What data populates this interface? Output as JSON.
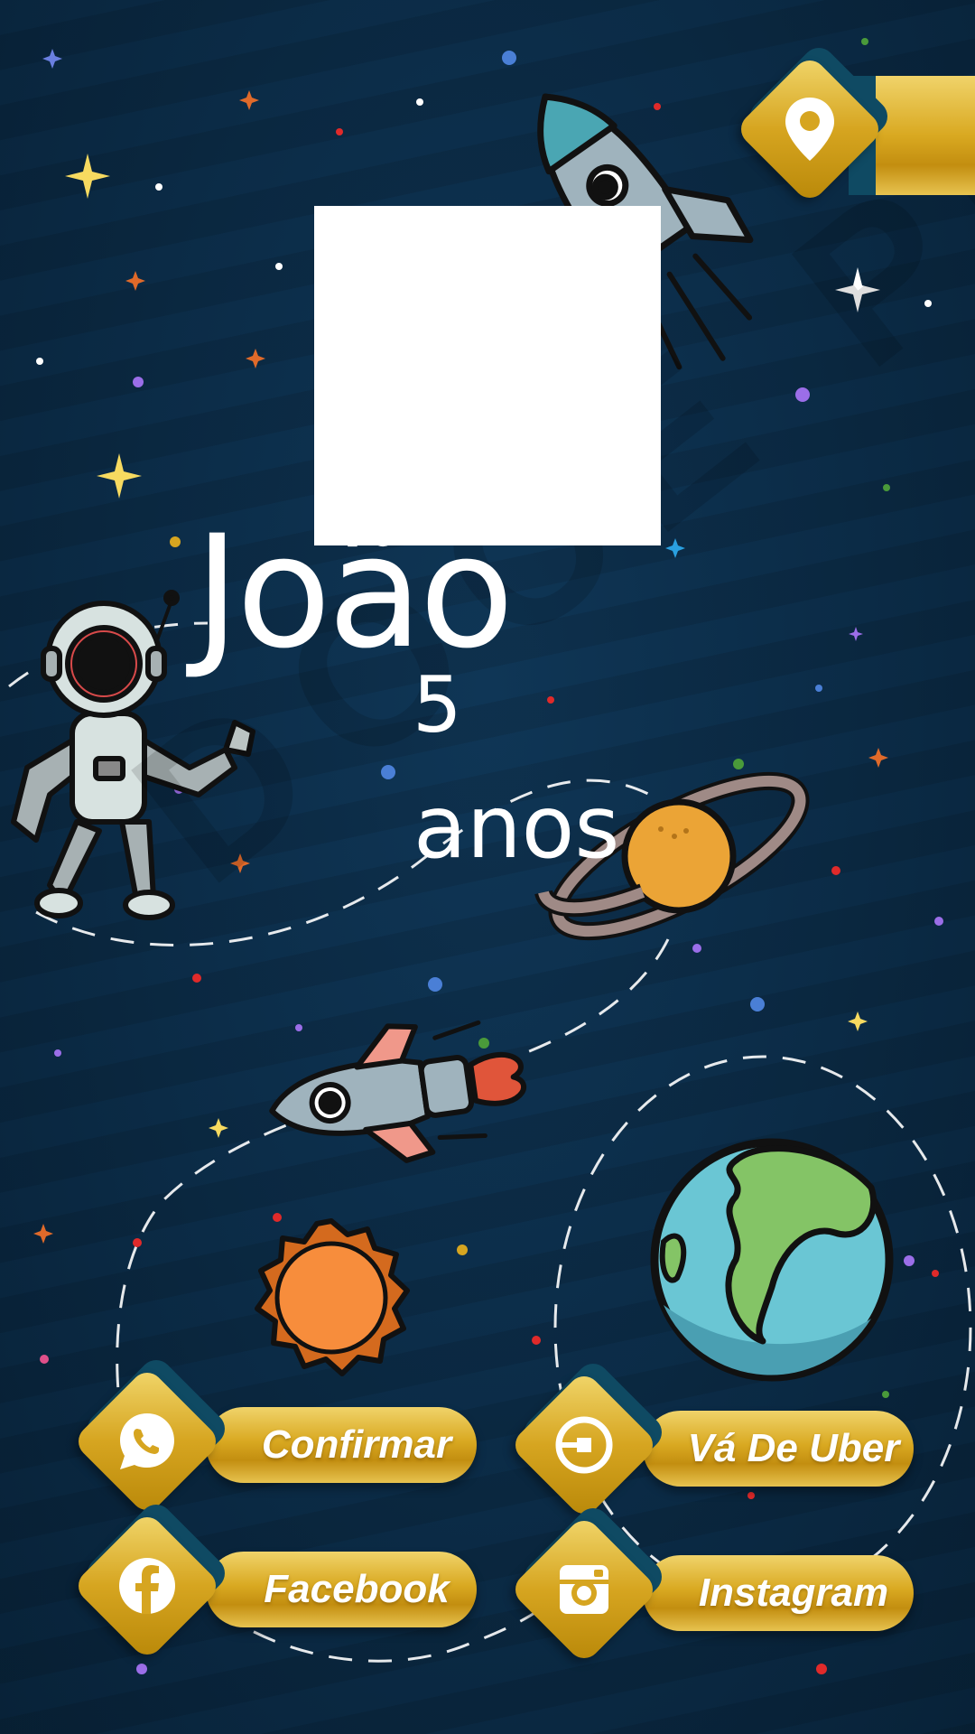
{
  "event": {
    "name": "João",
    "age": "5",
    "age_word": "anos"
  },
  "watermark": "DOCE PRINT",
  "location_button": {
    "icon": "map-pin-icon"
  },
  "actions": [
    {
      "label": "Confirmar",
      "icon": "whatsapp-icon"
    },
    {
      "label": "Vá De Uber",
      "icon": "uber-icon"
    },
    {
      "label": "Facebook",
      "icon": "facebook-icon"
    },
    {
      "label": "Instagram",
      "icon": "instagram-icon"
    }
  ],
  "colors": {
    "background": "#0b2b46",
    "gold": "#d9a921",
    "text": "#ffffff"
  }
}
